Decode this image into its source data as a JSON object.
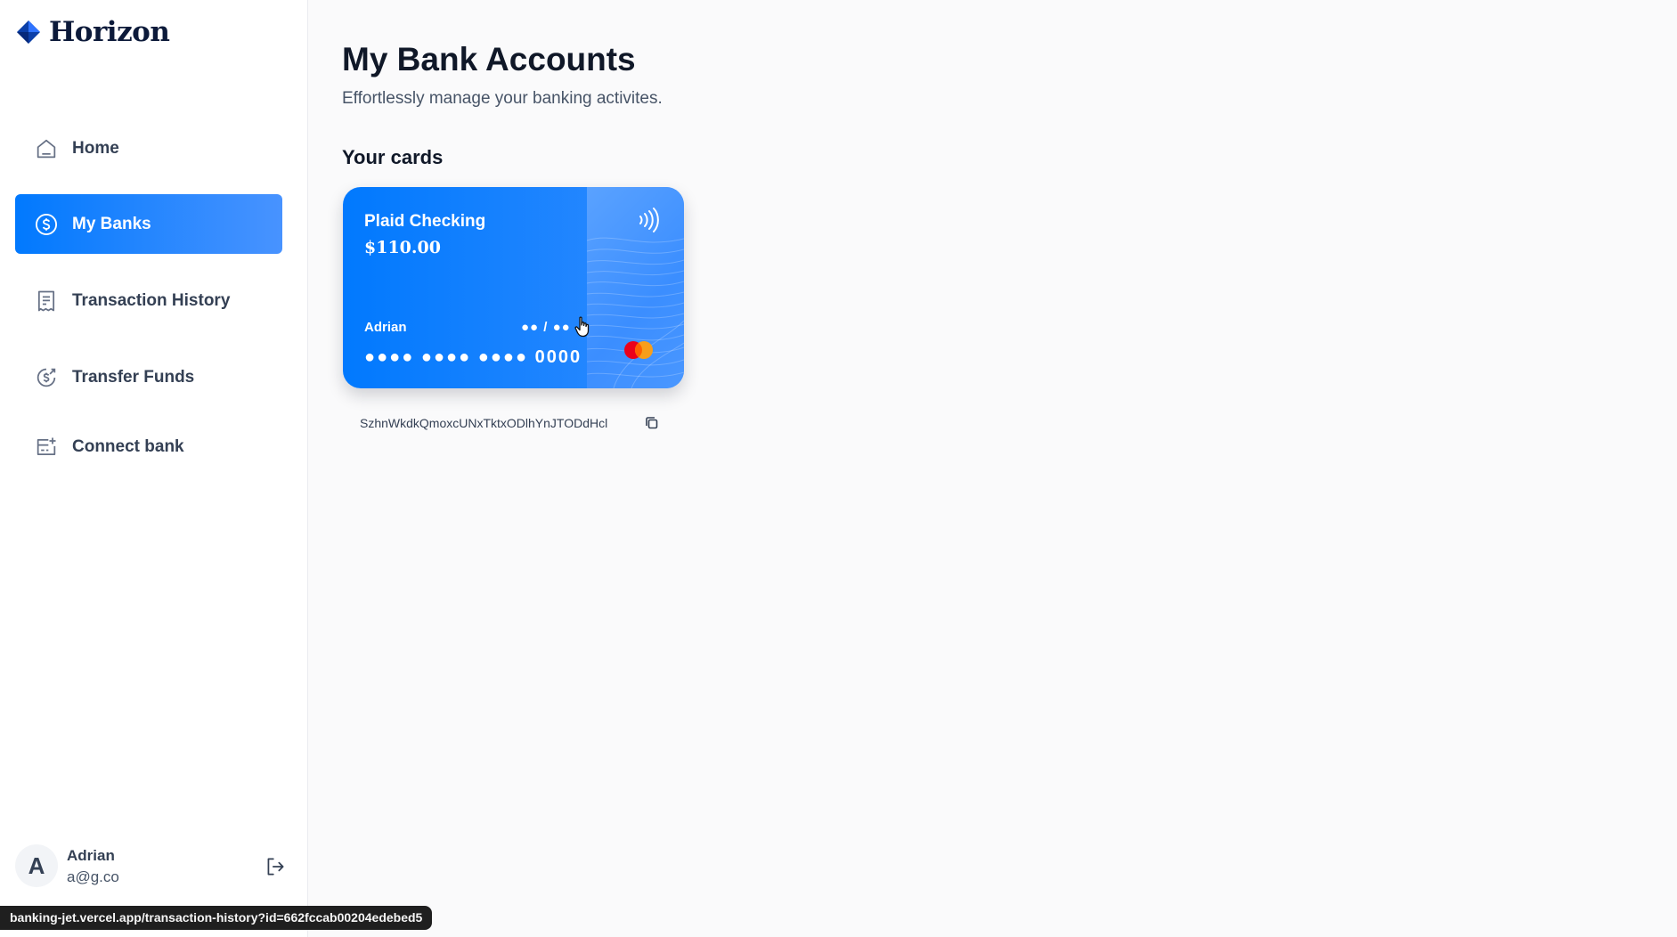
{
  "brand": {
    "name": "Horizon"
  },
  "sidebar": {
    "items": [
      {
        "label": "Home",
        "icon": "home-icon"
      },
      {
        "label": "My Banks",
        "icon": "dollar-circle-icon",
        "active": true
      },
      {
        "label": "Transaction History",
        "icon": "receipt-icon"
      },
      {
        "label": "Transfer Funds",
        "icon": "money-send-icon"
      },
      {
        "label": "Connect bank",
        "icon": "connect-bank-icon"
      }
    ]
  },
  "profile": {
    "initial": "A",
    "name": "Adrian",
    "email": "a@g.co"
  },
  "main": {
    "title": "My Bank Accounts",
    "subtitle": "Effortlessly manage your banking activites.",
    "section_title": "Your cards"
  },
  "card": {
    "bank_name": "Plaid Checking",
    "balance": "$110.00",
    "holder": "Adrian",
    "expiry": "●● / ●●",
    "number": "●●●● ●●●● ●●●● 0000",
    "network_icon": "mastercard-icon",
    "accent": "#0179fe"
  },
  "account": {
    "shareable_id": "SzhnWkdkQmoxcUNxTktxODlhYnJTODdHcl"
  },
  "statusbar": {
    "url": "banking-jet.vercel.app/transaction-history?id=662fccab00204edebed5"
  }
}
